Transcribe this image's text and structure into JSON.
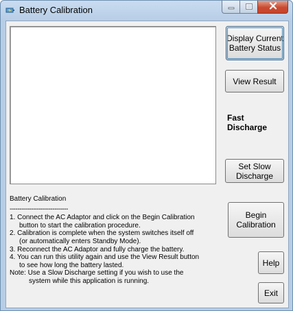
{
  "window": {
    "title": "Battery Calibration",
    "icon": "battery-app-icon"
  },
  "caption_buttons": {
    "minimize_icon": "minimize-icon",
    "maximize_icon": "maximize-icon",
    "close_icon": "close-icon"
  },
  "buttons": {
    "display_status": "Display Current Battery Status",
    "view_result": "View Result",
    "set_slow_discharge": "Set Slow Discharge",
    "begin_calibration": "Begin Calibration",
    "help": "Help",
    "exit": "Exit"
  },
  "discharge_mode": "Fast Discharge",
  "instructions": {
    "heading": "Battery Calibration",
    "rule": "------------------------------",
    "lines": [
      "1. Connect the AC Adaptor and click on the Begin Calibration",
      "button to start the calibration procedure.",
      "2. Calibration is complete when the system switches itself off",
      "(or automatically enters Standby Mode).",
      "3. Reconnect the AC Adaptor and fully charge the battery.",
      "4. You can run this utility again and use the View Result button",
      "to see how long the battery lasted.",
      "Note: Use a Slow Discharge setting if you wish to use the",
      "system while this application is running."
    ]
  },
  "colors": {
    "title_bar": "#b7cde6",
    "close_button": "#c94b31",
    "client_background": "#f0f0f0",
    "default_button_focus": "#3c7fb1"
  }
}
